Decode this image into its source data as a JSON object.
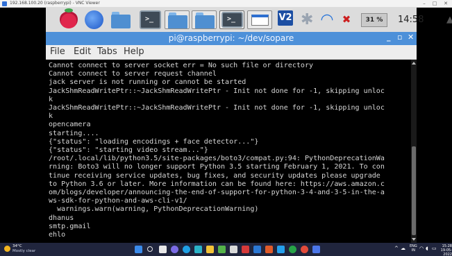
{
  "vnc": {
    "title": "192.168.100.20 (raspberrypi) - VNC Viewer",
    "controls": [
      "–",
      "□",
      "✕"
    ]
  },
  "pi_panel": {
    "cpu_usage": "31 %",
    "clock": "14:58"
  },
  "terminal_window": {
    "title": "pi@raspberrypi: ~/dev/sopare",
    "controls": [
      "_",
      "▫",
      "✕"
    ],
    "menu": [
      "File",
      "Edit",
      "Tabs",
      "Help"
    ],
    "lines": [
      "Cannot connect to server socket err = No such file or directory",
      "Cannot connect to server request channel",
      "jack server is not running or cannot be started",
      "JackShmReadWritePtr::~JackShmReadWritePtr - Init not done for -1, skipping unloc",
      "k",
      "JackShmReadWritePtr::~JackShmReadWritePtr - Init not done for -1, skipping unloc",
      "k",
      "opencamera",
      "starting....",
      "{\"status\": \"loading encodings + face detector...\"}",
      "{\"status\": \"starting video stream...\"}",
      "/root/.local/lib/python3.5/site-packages/boto3/compat.py:94: PythonDeprecationWa",
      "rning: Boto3 will no longer support Python 3.5 starting February 1, 2021. To con",
      "tinue receiving service updates, bug fixes, and security updates please upgrade",
      "to Python 3.6 or later. More information can be found here: https://aws.amazon.c",
      "om/blogs/developer/announcing-the-end-of-support-for-python-3-4-and-3-5-in-the-a",
      "ws-sdk-for-python-and-aws-cli-v1/",
      "  warnings.warn(warning, PythonDeprecationWarning)",
      "dhanus",
      "smtp.gmail",
      "ehlo"
    ]
  },
  "taskbar": {
    "weather_temp": "34°C",
    "weather_cond": "Mostly clear",
    "lang_top": "ENG",
    "lang_bottom": "IN",
    "time": "15:28",
    "date": "19-05-2022"
  },
  "colors": {
    "pi_panel": "#dcdcdc",
    "terminal_title": "#4d90d9",
    "terminal_text": "#d7d7d7",
    "taskbar": "#20253d"
  }
}
